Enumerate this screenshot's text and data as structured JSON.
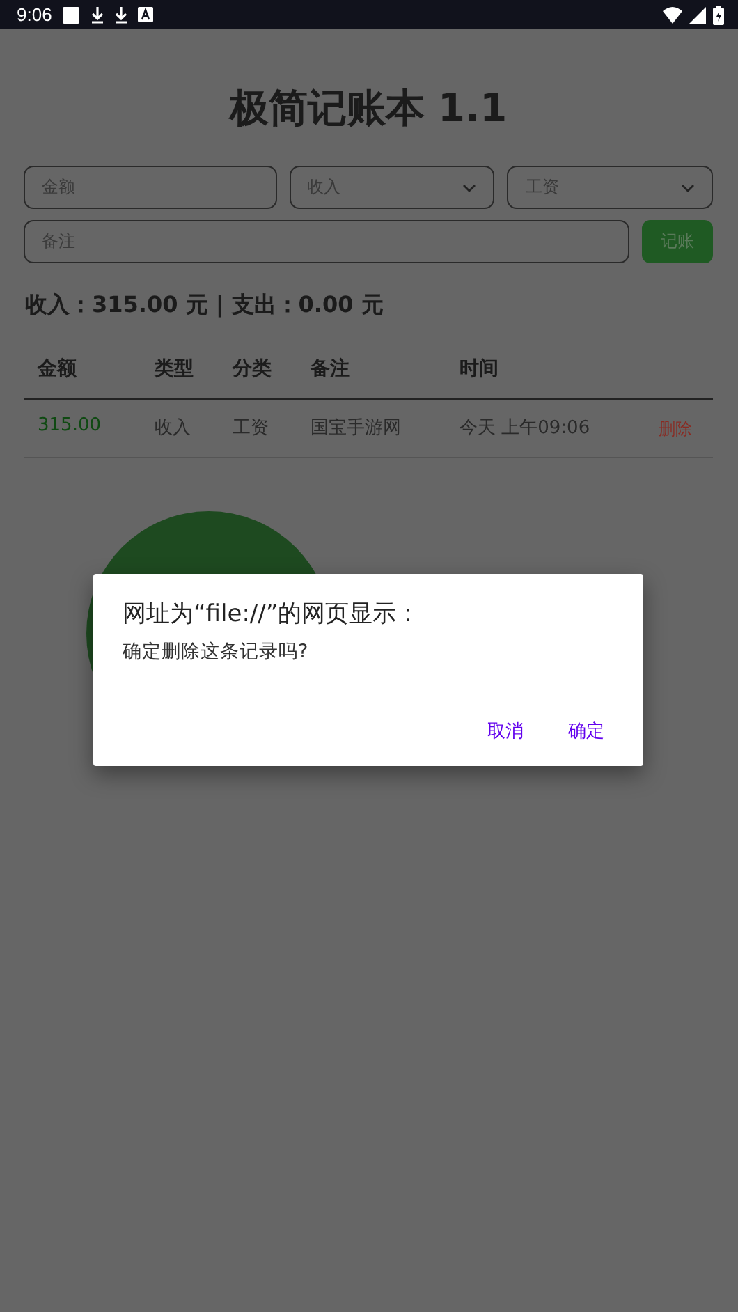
{
  "status_bar": {
    "time": "9:06"
  },
  "title": "极简记账本 1.1",
  "form": {
    "amount": {
      "placeholder": "金额"
    },
    "type": {
      "value": "收入"
    },
    "category": {
      "value": "工资"
    },
    "note": {
      "placeholder": "备注"
    },
    "submit": "记账"
  },
  "summary": "收入：315.00 元 | 支出：0.00 元",
  "table": {
    "columns": [
      "金额",
      "类型",
      "分类",
      "备注",
      "时间"
    ],
    "rows": [
      {
        "kind": "income",
        "amount": "315.00",
        "type": "收入",
        "category": "工资",
        "note": "国宝手游网",
        "time": "今天 上午09:06",
        "action": "删除"
      }
    ]
  },
  "dialog": {
    "title": "网址为“file://”的网页显示：",
    "message": "确定删除这条记录吗?",
    "buttons": [
      "取消",
      "确定"
    ]
  }
}
